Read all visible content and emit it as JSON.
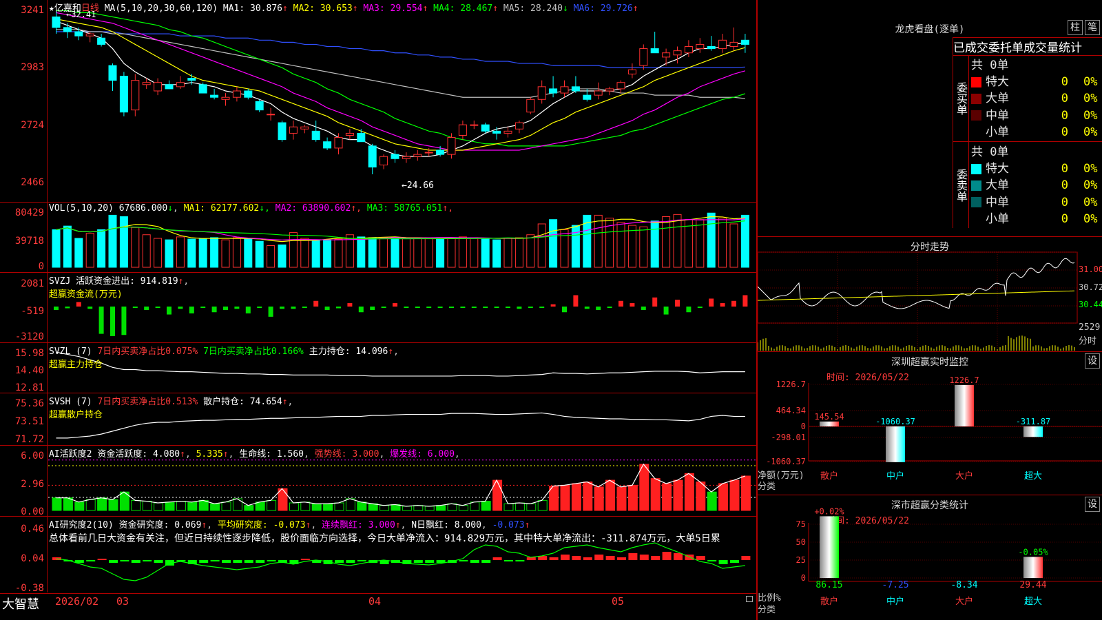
{
  "main": {
    "stock_name": "亿嘉和",
    "period": "日线",
    "ma_label": "MA(5,10,20,30,60,120)",
    "ma_values": [
      {
        "name": "MA1",
        "value": "30.876",
        "dir": "↑",
        "color": "#ffffff"
      },
      {
        "name": "MA2",
        "value": "30.653",
        "dir": "↑",
        "color": "#ffff00"
      },
      {
        "name": "MA3",
        "value": "29.554",
        "dir": "↑",
        "color": "#ff00ff"
      },
      {
        "name": "MA4",
        "value": "28.467",
        "dir": "↑",
        "color": "#00ff00"
      },
      {
        "name": "MA5",
        "value": "28.240",
        "dir": "↓",
        "color": "#c0c0c0"
      },
      {
        "name": "MA6",
        "value": "29.726",
        "dir": "↑",
        "color": "#3050ff"
      }
    ],
    "y_ticks": [
      "3241",
      "2983",
      "2724",
      "2466"
    ],
    "high_label": "32.41",
    "low_label": "←24.66",
    "candles": [
      [
        32.1,
        32.41,
        31.3,
        31.6
      ],
      [
        31.6,
        31.8,
        31.1,
        31.4
      ],
      [
        31.4,
        31.6,
        31.0,
        31.2
      ],
      [
        31.2,
        31.4,
        30.9,
        31.3
      ],
      [
        31.1,
        31.3,
        30.7,
        30.8
      ],
      [
        29.8,
        29.9,
        28.6,
        29.1
      ],
      [
        29.3,
        29.5,
        27.4,
        27.6
      ],
      [
        27.7,
        29.4,
        27.4,
        29.1
      ],
      [
        28.9,
        29.2,
        28.7,
        29.0
      ],
      [
        28.6,
        29.2,
        28.4,
        29.0
      ],
      [
        28.9,
        29.1,
        28.7,
        28.7
      ],
      [
        28.8,
        29.3,
        28.7,
        29.0
      ],
      [
        29.2,
        29.4,
        28.9,
        29.1
      ],
      [
        28.9,
        29.0,
        28.5,
        28.5
      ],
      [
        28.4,
        28.7,
        28.2,
        28.3
      ],
      [
        28.2,
        28.5,
        27.9,
        28.3
      ],
      [
        28.3,
        28.8,
        28.1,
        28.6
      ],
      [
        28.6,
        28.7,
        28.2,
        28.3
      ],
      [
        28.1,
        28.2,
        27.6,
        27.7
      ],
      [
        27.5,
        27.8,
        27.2,
        27.5
      ],
      [
        27.1,
        27.2,
        26.2,
        26.3
      ],
      [
        26.6,
        27.2,
        26.3,
        26.9
      ],
      [
        26.8,
        27.0,
        26.6,
        26.9
      ],
      [
        26.7,
        27.2,
        26.2,
        26.3
      ],
      [
        26.2,
        26.4,
        25.8,
        25.9
      ],
      [
        25.9,
        26.6,
        25.6,
        26.4
      ],
      [
        26.5,
        26.8,
        26.3,
        26.6
      ],
      [
        26.6,
        26.8,
        26.2,
        26.2
      ],
      [
        26.0,
        26.1,
        24.66,
        25.0
      ],
      [
        25.1,
        25.6,
        24.9,
        25.5
      ],
      [
        25.6,
        25.8,
        25.2,
        25.4
      ],
      [
        25.4,
        25.7,
        25.2,
        25.5
      ],
      [
        25.5,
        25.8,
        25.3,
        25.6
      ],
      [
        25.7,
        25.9,
        25.5,
        25.7
      ],
      [
        25.8,
        26.0,
        25.5,
        25.6
      ],
      [
        25.6,
        26.6,
        25.4,
        26.4
      ],
      [
        26.5,
        27.2,
        26.3,
        27.0
      ],
      [
        27.0,
        27.2,
        26.8,
        27.0
      ],
      [
        27.0,
        27.1,
        26.6,
        26.7
      ],
      [
        26.7,
        26.9,
        26.3,
        26.6
      ],
      [
        26.6,
        26.9,
        26.4,
        26.7
      ],
      [
        26.8,
        27.2,
        26.6,
        27.1
      ],
      [
        27.6,
        28.3,
        27.5,
        28.2
      ],
      [
        28.2,
        29.1,
        28.0,
        28.8
      ],
      [
        28.7,
        29.3,
        28.3,
        28.5
      ],
      [
        28.5,
        29.1,
        28.3,
        28.8
      ],
      [
        28.8,
        29.3,
        28.5,
        28.6
      ],
      [
        28.4,
        28.7,
        28.1,
        28.2
      ],
      [
        28.4,
        29.0,
        28.2,
        28.6
      ],
      [
        28.6,
        28.8,
        28.4,
        28.7
      ],
      [
        28.7,
        29.1,
        28.5,
        29.0
      ],
      [
        29.4,
        29.9,
        29.2,
        29.6
      ],
      [
        29.8,
        30.8,
        29.6,
        30.6
      ],
      [
        30.6,
        31.4,
        30.4,
        30.4
      ],
      [
        30.2,
        30.6,
        29.8,
        30.4
      ],
      [
        30.3,
        30.7,
        29.9,
        30.5
      ],
      [
        30.4,
        31.0,
        30.2,
        30.7
      ],
      [
        30.6,
        31.1,
        30.4,
        30.8
      ],
      [
        30.7,
        31.2,
        30.5,
        30.6
      ],
      [
        30.6,
        31.3,
        30.4,
        31.0
      ],
      [
        30.7,
        31.6,
        30.5,
        30.9
      ],
      [
        31.0,
        31.3,
        30.4,
        30.8
      ]
    ],
    "ma5": [
      31.9,
      31.7,
      31.5,
      31.3,
      31.1,
      30.6,
      29.9,
      29.5,
      29.2,
      28.9,
      28.9,
      28.9,
      29.0,
      28.9,
      28.8,
      28.6,
      28.5,
      28.4,
      28.2,
      28.0,
      27.6,
      27.3,
      27.1,
      26.9,
      26.7,
      26.4,
      26.3,
      26.3,
      26.0,
      25.8,
      25.6,
      25.5,
      25.5,
      25.5,
      25.6,
      25.8,
      26.0,
      26.3,
      26.6,
      26.8,
      26.9,
      27.0,
      27.2,
      27.6,
      28.0,
      28.3,
      28.6,
      28.6,
      28.6,
      28.6,
      28.7,
      28.9,
      29.3,
      29.6,
      29.9,
      30.1,
      30.4,
      30.6,
      30.6,
      30.7,
      30.8,
      30.88
    ],
    "ma10": [
      32.0,
      31.9,
      31.8,
      31.7,
      31.6,
      31.4,
      31.1,
      30.8,
      30.5,
      30.2,
      29.9,
      29.6,
      29.3,
      29.1,
      29.0,
      28.9,
      28.8,
      28.7,
      28.6,
      28.4,
      28.2,
      28.0,
      27.8,
      27.6,
      27.4,
      27.1,
      26.9,
      26.7,
      26.5,
      26.3,
      26.1,
      26.0,
      25.9,
      25.8,
      25.8,
      25.8,
      25.8,
      25.9,
      26.0,
      26.1,
      26.2,
      26.3,
      26.5,
      26.8,
      27.1,
      27.3,
      27.6,
      27.8,
      28.0,
      28.2,
      28.4,
      28.6,
      28.8,
      29.1,
      29.3,
      29.5,
      29.7,
      29.9,
      30.1,
      30.3,
      30.5,
      30.65
    ],
    "ma20": [
      32.3,
      32.2,
      32.1,
      32.0,
      31.9,
      31.8,
      31.6,
      31.4,
      31.2,
      31.0,
      30.8,
      30.6,
      30.4,
      30.2,
      30.0,
      29.8,
      29.6,
      29.4,
      29.2,
      29.0,
      28.8,
      28.5,
      28.3,
      28.1,
      27.8,
      27.6,
      27.4,
      27.2,
      26.9,
      26.7,
      26.5,
      26.3,
      26.1,
      26.0,
      25.9,
      25.8,
      25.8,
      25.8,
      25.8,
      25.8,
      25.8,
      25.8,
      25.9,
      26.0,
      26.1,
      26.2,
      26.3,
      26.4,
      26.6,
      26.8,
      27.0,
      27.2,
      27.5,
      27.7,
      28.0,
      28.3,
      28.5,
      28.8,
      29.0,
      29.2,
      29.4,
      29.55
    ],
    "ma30": [
      32.4,
      32.4,
      32.3,
      32.3,
      32.2,
      32.1,
      32.0,
      31.9,
      31.8,
      31.7,
      31.5,
      31.4,
      31.2,
      31.1,
      30.9,
      30.7,
      30.5,
      30.3,
      30.1,
      29.9,
      29.7,
      29.4,
      29.2,
      29.0,
      28.7,
      28.5,
      28.2,
      28.0,
      27.8,
      27.6,
      27.3,
      27.1,
      26.9,
      26.7,
      26.6,
      26.4,
      26.3,
      26.2,
      26.1,
      26.1,
      26.0,
      26.0,
      26.0,
      26.0,
      26.0,
      26.0,
      26.1,
      26.2,
      26.3,
      26.4,
      26.5,
      26.7,
      26.8,
      27.0,
      27.2,
      27.4,
      27.6,
      27.8,
      28.0,
      28.2,
      28.3,
      28.47
    ],
    "ma60": [
      31.5,
      31.5,
      31.5,
      31.4,
      31.4,
      31.3,
      31.3,
      31.2,
      31.1,
      31.0,
      30.9,
      30.8,
      30.7,
      30.6,
      30.5,
      30.4,
      30.3,
      30.2,
      30.1,
      30.0,
      29.9,
      29.8,
      29.7,
      29.6,
      29.5,
      29.4,
      29.3,
      29.2,
      29.1,
      29.0,
      28.9,
      28.8,
      28.7,
      28.6,
      28.5,
      28.4,
      28.3,
      28.3,
      28.3,
      28.3,
      28.3,
      28.3,
      28.3,
      28.4,
      28.5,
      28.6,
      28.7,
      28.7,
      28.7,
      28.6,
      28.5,
      28.5,
      28.5,
      28.4,
      28.4,
      28.4,
      28.4,
      28.3,
      28.3,
      28.3,
      28.3,
      28.24
    ],
    "ma120": [
      31.4,
      31.4,
      31.4,
      31.4,
      31.4,
      31.4,
      31.3,
      31.3,
      31.3,
      31.3,
      31.3,
      31.2,
      31.2,
      31.2,
      31.2,
      31.1,
      31.1,
      31.1,
      31.0,
      31.0,
      30.9,
      30.9,
      30.8,
      30.8,
      30.7,
      30.7,
      30.6,
      30.6,
      30.5,
      30.5,
      30.4,
      30.4,
      30.3,
      30.3,
      30.2,
      30.2,
      30.1,
      30.1,
      30.0,
      30.0,
      30.0,
      29.9,
      29.9,
      29.9,
      29.8,
      29.8,
      29.8,
      29.8,
      29.8,
      29.7,
      29.7,
      29.7,
      29.7,
      29.7,
      29.7,
      29.7,
      29.7,
      29.7,
      29.7,
      29.7,
      29.7,
      29.73
    ]
  },
  "vol": {
    "label": "VOL(5,10,20)",
    "value": "67686.000",
    "value_dir": "↓",
    "ma": [
      {
        "name": "MA1",
        "value": "62177.602",
        "dir": "↓",
        "color": "#ffff00"
      },
      {
        "name": "MA2",
        "value": "63890.602",
        "dir": "↑",
        "color": "#ff00ff"
      },
      {
        "name": "MA3",
        "value": "58765.051",
        "dir": "↑",
        "color": "#00ff00"
      }
    ],
    "y_ticks": [
      "80429",
      "39718",
      "0"
    ],
    "bars": [
      52,
      57,
      40,
      47,
      52,
      72,
      70,
      55,
      45,
      40,
      38,
      42,
      39,
      40,
      41,
      38,
      41,
      40,
      36,
      30,
      31,
      48,
      40,
      37,
      38,
      39,
      45,
      42,
      41,
      41,
      41,
      40,
      41,
      41,
      40,
      40,
      42,
      41,
      39,
      38,
      40,
      41,
      45,
      60,
      66,
      52,
      58,
      72,
      72,
      68,
      62,
      58,
      56,
      64,
      70,
      73,
      66,
      66,
      75,
      68,
      60,
      72,
      68
    ],
    "up": [
      0,
      1,
      0,
      0,
      0,
      0,
      0,
      1,
      1,
      1,
      0,
      1,
      1,
      0,
      0,
      1,
      1,
      0,
      0,
      0,
      0,
      1,
      1,
      0,
      0,
      1,
      1,
      0,
      0,
      1,
      0,
      1,
      1,
      1,
      0,
      1,
      1,
      0,
      0,
      0,
      1,
      1,
      1,
      1,
      0,
      1,
      0,
      0,
      1,
      1,
      1,
      1,
      1,
      0,
      1,
      1,
      1,
      1,
      0,
      1,
      1,
      0
    ]
  },
  "svzj": {
    "label": "SVZJ",
    "title": "活跃资金进出:",
    "value": "914.819",
    "sub": "超赢资金流(万元)",
    "y_ticks": [
      "2081",
      "-519",
      "-3120"
    ],
    "values": [
      -300,
      -150,
      400,
      -200,
      -2400,
      -2600,
      -2500,
      -50,
      -300,
      -100,
      -700,
      -200,
      -600,
      -100,
      -500,
      -300,
      -200,
      -600,
      -100,
      -900,
      -200,
      -200,
      -100,
      500,
      -300,
      -150,
      300,
      -500,
      -300,
      -100,
      300,
      -50,
      -80,
      -50,
      -50,
      -100,
      -50,
      -40,
      -50,
      -80,
      -100,
      -200,
      -60,
      -90,
      200,
      -500,
      1000,
      -200,
      -300,
      -100,
      500,
      300,
      -300,
      800,
      -700,
      600,
      -500,
      -100,
      700,
      300,
      500,
      1000,
      -300
    ]
  },
  "svzl": {
    "label": "SVZL",
    "param": "(7)",
    "t1": "7日内买卖净占比0.075%",
    "t2": "7日内买卖净占比0.166%",
    "t3": "主力持仓:",
    "t3v": "14.096",
    "sub": "超赢主力持仓",
    "y_ticks": [
      "15.98",
      "14.40",
      "12.81"
    ]
  },
  "svsh": {
    "label": "SVSH",
    "param": "(7)",
    "t1": "7日内买卖净占比0.513%",
    "t2": "散户持仓:",
    "t2v": "74.654",
    "sub": "超赢散户持仓",
    "y_ticks": [
      "75.36",
      "73.51",
      "71.72"
    ]
  },
  "ai1": {
    "label": "AI活跃度2",
    "t1": "资金活跃度:",
    "v1": "4.080",
    "v2": "5.335",
    "t3": "生命线:",
    "v3": "1.560",
    "t4": "强势线:",
    "v4": "3.000",
    "t5": "爆发线:",
    "v5": "6.000",
    "y_ticks": [
      "6.00",
      "2.96",
      "0.00"
    ]
  },
  "ai2": {
    "label": "AI研究度2(10)",
    "t1": "资金研究度:",
    "v1": "0.069",
    "t2": "平均研究度:",
    "v2": "-0.073",
    "t3": "连续飘红:",
    "v3": "3.000",
    "t4": "N日飘红:",
    "v4": "8.000",
    "v5": "-0.073",
    "summary": "总体看前几日大资金有关注，但近日持续性逐步降低，股价面临方向选择，今日大单净流入：914.829万元，其中特大单净流出：-311.874万元，大单5日累",
    "y_ticks": [
      "0.46",
      "0.04",
      "-0.38"
    ]
  },
  "bottom": {
    "brand": "大智慧",
    "dates": [
      "2026/02",
      "03",
      "04",
      "05"
    ]
  },
  "right": {
    "lhb_title": "龙虎看盘(逐单)",
    "btn_zhu": "柱",
    "btn_bi": "笔",
    "tabs": [
      "已成交",
      "委托单",
      "成交量统计"
    ],
    "buy": {
      "side": "委买单",
      "total": "共 0单",
      "rows": [
        {
          "label": "特大",
          "v": "0",
          "p": "0%",
          "color": "#ff0000"
        },
        {
          "label": "大单",
          "v": "0",
          "p": "0%",
          "color": "#8b0000"
        },
        {
          "label": "中单",
          "v": "0",
          "p": "0%",
          "color": "#5a0000"
        },
        {
          "label": "小单",
          "v": "0",
          "p": "0%",
          "color": "#000000"
        }
      ]
    },
    "sell": {
      "side": "委卖单",
      "total": "共 0单",
      "rows": [
        {
          "label": "特大",
          "v": "0",
          "p": "0%",
          "color": "#00ffff"
        },
        {
          "label": "大单",
          "v": "0",
          "p": "0%",
          "color": "#008b8b"
        },
        {
          "label": "中单",
          "v": "0",
          "p": "0%",
          "color": "#006060"
        },
        {
          "label": "小单",
          "v": "0",
          "p": "0%",
          "color": "#000000"
        }
      ]
    },
    "intraday": {
      "title": "分时走势",
      "y": [
        "31.00",
        "30.72",
        "30.44"
      ],
      "vol": "2529",
      "unit": "分时"
    },
    "monitor": {
      "title": "深圳超赢实时监控",
      "btn": "设",
      "time": "时间: 2026/05/22",
      "y": [
        "1226.7",
        "464.34",
        "0",
        "-298.01",
        "-1060.37"
      ],
      "bars": [
        {
          "cat": "散户",
          "v": 145.54,
          "label": "145.54"
        },
        {
          "cat": "中户",
          "v": -1060.37,
          "label": "-1060.37"
        },
        {
          "cat": "大户",
          "v": 1226.7,
          "label": "1226.7"
        },
        {
          "cat": "超大",
          "v": -311.87,
          "label": "-311.87"
        }
      ],
      "ylabel": "净额(万元)",
      "xlabel": "分类"
    },
    "stats": {
      "title": "深市超赢分类统计",
      "btn": "设",
      "time": "时间: 2026/05/22",
      "y": [
        "75",
        "50",
        "25",
        "0"
      ],
      "bars": [
        {
          "cat": "散户",
          "v": 86.15,
          "label": "86.15",
          "chg": "+0.02%"
        },
        {
          "cat": "中户",
          "v": 7.25,
          "label": "-7.25",
          "chg": ""
        },
        {
          "cat": "大户",
          "v": 8.34,
          "label": "-8.34",
          "chg": ""
        },
        {
          "cat": "超大",
          "v": 29.44,
          "label": "29.44",
          "chg": "-0.05%"
        }
      ],
      "ylabel": "比例%",
      "xlabel": "分类"
    }
  }
}
